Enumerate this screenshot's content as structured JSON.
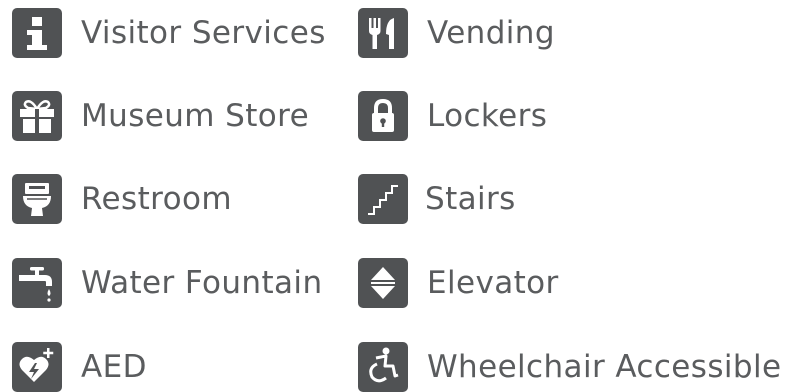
{
  "items": [
    {
      "label": "Visitor Services",
      "icon": "info-icon"
    },
    {
      "label": "Vending",
      "icon": "fork-knife-icon"
    },
    {
      "label": "Museum Store",
      "icon": "gift-icon"
    },
    {
      "label": "Lockers",
      "icon": "lock-icon"
    },
    {
      "label": "Restroom",
      "icon": "toilet-icon"
    },
    {
      "label": "Stairs",
      "icon": "stairs-icon"
    },
    {
      "label": "Water Fountain",
      "icon": "water-fountain-icon"
    },
    {
      "label": "Elevator",
      "icon": "elevator-icon"
    },
    {
      "label": "AED",
      "icon": "aed-heart-icon"
    },
    {
      "label": "Wheelchair Accessible",
      "icon": "wheelchair-icon"
    }
  ],
  "colors": {
    "icon_background": "#505254",
    "icon_foreground": "#ffffff",
    "label_text": "#5a5c5e"
  }
}
